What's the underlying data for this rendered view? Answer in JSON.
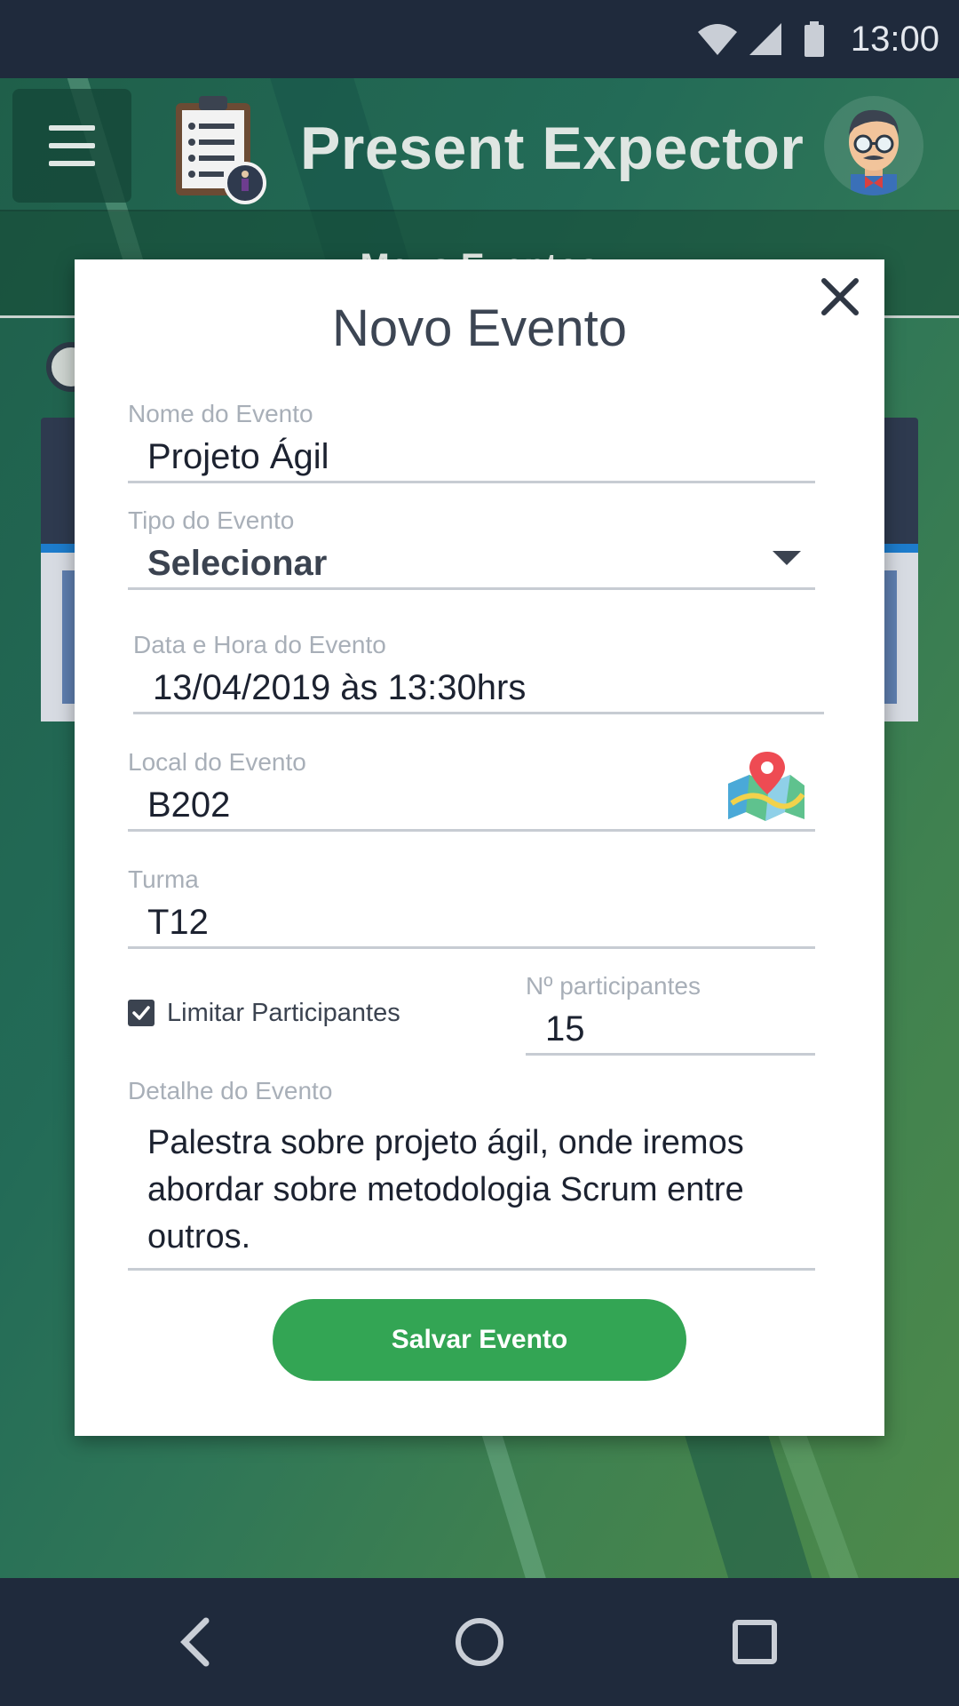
{
  "status_bar": {
    "time": "13:00",
    "icons": [
      "wifi-icon",
      "signal-icon",
      "battery-icon"
    ]
  },
  "app_bar": {
    "title": "Present Expector",
    "menu_icon": "hamburger-menu-icon",
    "logo_icon": "clipboard-checklist-icon",
    "avatar_icon": "avatar-man-glasses-icon"
  },
  "background": {
    "tab_label": "Meus Eventos"
  },
  "modal": {
    "title": "Novo Evento",
    "fields": {
      "event_name": {
        "label": "Nome do Evento",
        "value": "Projeto Ágil"
      },
      "event_type": {
        "label": "Tipo do Evento",
        "value": "Selecionar"
      },
      "event_datetime": {
        "label": "Data e Hora do Evento",
        "value": "13/04/2019 às 13:30hrs"
      },
      "event_location": {
        "label": "Local do Evento",
        "value": "B202",
        "icon": "map-pin-icon"
      },
      "class_group": {
        "label": "Turma",
        "value": "T12"
      },
      "limit_participants": {
        "label": "Limitar Participantes",
        "checked": true
      },
      "participants_count": {
        "label": "Nº participantes",
        "value": "15"
      },
      "event_detail": {
        "label": "Detalhe do Evento",
        "value": "Palestra sobre projeto ágil, onde iremos abordar sobre metodologia Scrum entre outros."
      }
    },
    "save_label": "Salvar Evento"
  },
  "nav_bar": {
    "icons": [
      "back-icon",
      "home-icon",
      "recents-icon"
    ]
  },
  "colors": {
    "status_bar": "#1f2a3c",
    "app_green_dark": "#1f5f4a",
    "app_green_light": "#4e8a4a",
    "save_button": "#33a554",
    "text_dark": "#3b4350",
    "label_gray": "#a8afb8"
  }
}
